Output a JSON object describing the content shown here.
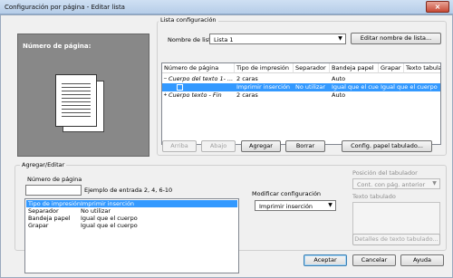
{
  "window": {
    "title": "Configuración por página - Editar lista",
    "close_glyph": "×"
  },
  "preview": {
    "label": "Número de página:"
  },
  "list_config": {
    "group_title": "Lista configuración",
    "list_name_label": "Nombre de lista",
    "list_name_value": "Lista 1",
    "edit_name_button": "Editar nombre de lista...",
    "columns": [
      "Número de página",
      "Tipo de impresión",
      "Separador",
      "Bandeja papel",
      "Grapar",
      "Texto tabulado"
    ],
    "rows": [
      {
        "page": "Cuerpo del texto 1- ...",
        "print_type": "2 caras",
        "separator": "",
        "tray": "Auto",
        "staple": "",
        "tab_text": "",
        "italic": true,
        "selected": false,
        "expander": "−"
      },
      {
        "page": "",
        "print_type": "Imprimir inserción",
        "separator": "No utilizar",
        "tray": "Igual que el cuerpo",
        "staple": "Igual que el cuerpo",
        "tab_text": "",
        "italic": false,
        "selected": true,
        "child": true
      },
      {
        "page": "Cuerpo texto - Fin",
        "print_type": "2 caras",
        "separator": "",
        "tray": "Auto",
        "staple": "",
        "tab_text": "",
        "italic": true,
        "selected": false,
        "expander": "+"
      }
    ],
    "buttons": {
      "up": "Arriba",
      "down": "Abajo",
      "add": "Agregar",
      "delete": "Borrar",
      "tab_paper_config": "Config. papel tabulado..."
    }
  },
  "add_edit": {
    "group_title": "Agregar/Editar",
    "page_number_label": "Número de página",
    "page_number_value": "",
    "example_text": "Ejemplo de entrada 2, 4, 6-10",
    "settings": [
      {
        "name": "Tipo de impresión",
        "value": "Imprimir inserción",
        "selected": true
      },
      {
        "name": "Separador",
        "value": "No utilizar",
        "selected": false
      },
      {
        "name": "Bandeja papel",
        "value": "Igual que el cuerpo",
        "selected": false
      },
      {
        "name": "Grapar",
        "value": "Igual que el cuerpo",
        "selected": false
      }
    ],
    "modify_label": "Modificar configuración",
    "modify_value": "Imprimir inserción",
    "tab_position_label": "Posición del tabulador",
    "tab_position_value": "Cont. con pág. anterior",
    "tab_text_label": "Texto tabulado",
    "tab_text_details_button": "Detalles de texto tabulado..."
  },
  "footer": {
    "ok_button": "Aceptar",
    "cancel_button": "Cancelar",
    "help_button": "Ayuda"
  },
  "colors": {
    "selection": "#3399ff",
    "preview_bg": "#888888"
  },
  "icons": [
    "page-icon",
    "close-icon",
    "dropdown-arrow-icon"
  ]
}
